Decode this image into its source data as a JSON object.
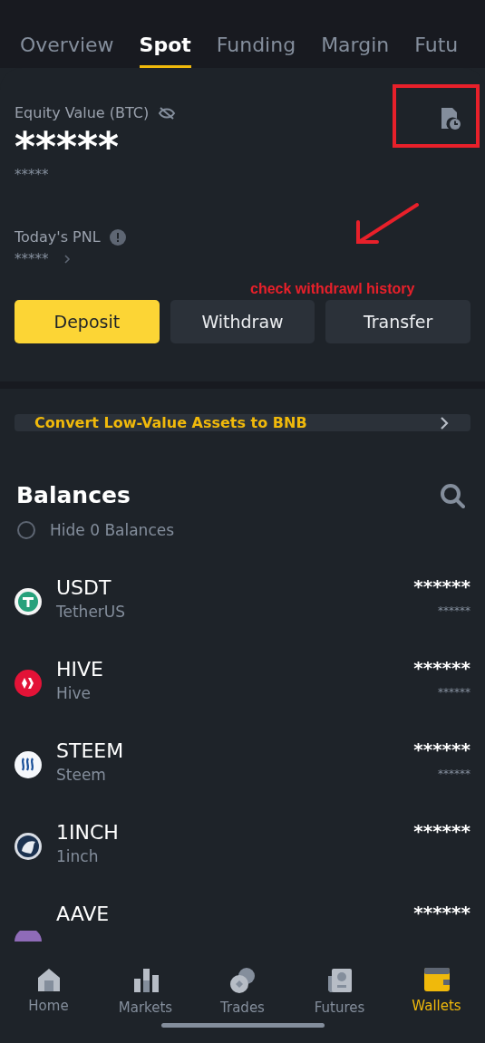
{
  "tabs": [
    {
      "label": "Overview",
      "selected": false
    },
    {
      "label": "Spot",
      "selected": true
    },
    {
      "label": "Funding",
      "selected": false
    },
    {
      "label": "Margin",
      "selected": false
    },
    {
      "label": "Futu",
      "selected": false
    }
  ],
  "summary": {
    "equity_label": "Equity Value (BTC)",
    "equity_value": "*****",
    "equity_sub": "*****",
    "pnl_label": "Today's PNL",
    "pnl_value": "*****"
  },
  "actions": [
    {
      "label": "Deposit",
      "primary": true
    },
    {
      "label": "Withdraw",
      "primary": false
    },
    {
      "label": "Transfer",
      "primary": false
    }
  ],
  "annotation": {
    "text": "check withdrawl history"
  },
  "convert_banner": {
    "text": "Convert Low-Value Assets to BNB"
  },
  "balances": {
    "title": "Balances",
    "hide_zero": {
      "label": "Hide 0 Balances",
      "checked": false
    },
    "rows": [
      {
        "kind": "tether",
        "symbol": "USDT",
        "name": "TetherUS",
        "amount": "******",
        "sub_amount": "******"
      },
      {
        "kind": "hive",
        "symbol": "HIVE",
        "name": "Hive",
        "amount": "******",
        "sub_amount": "******"
      },
      {
        "kind": "steem",
        "symbol": "STEEM",
        "name": "Steem",
        "amount": "******",
        "sub_amount": "******"
      },
      {
        "kind": "unicorn",
        "symbol": "1INCH",
        "name": "1inch",
        "amount": "******"
      },
      {
        "kind": "aave",
        "symbol": "AAVE",
        "amount": "******"
      }
    ]
  },
  "bottom_nav": [
    {
      "kind": "home",
      "label": "Home",
      "selected": false
    },
    {
      "kind": "markets",
      "label": "Markets",
      "selected": false
    },
    {
      "kind": "trades",
      "label": "Trades",
      "selected": false
    },
    {
      "kind": "futures",
      "label": "Futures",
      "selected": false
    },
    {
      "kind": "wallets",
      "label": "Wallets",
      "selected": true
    }
  ]
}
